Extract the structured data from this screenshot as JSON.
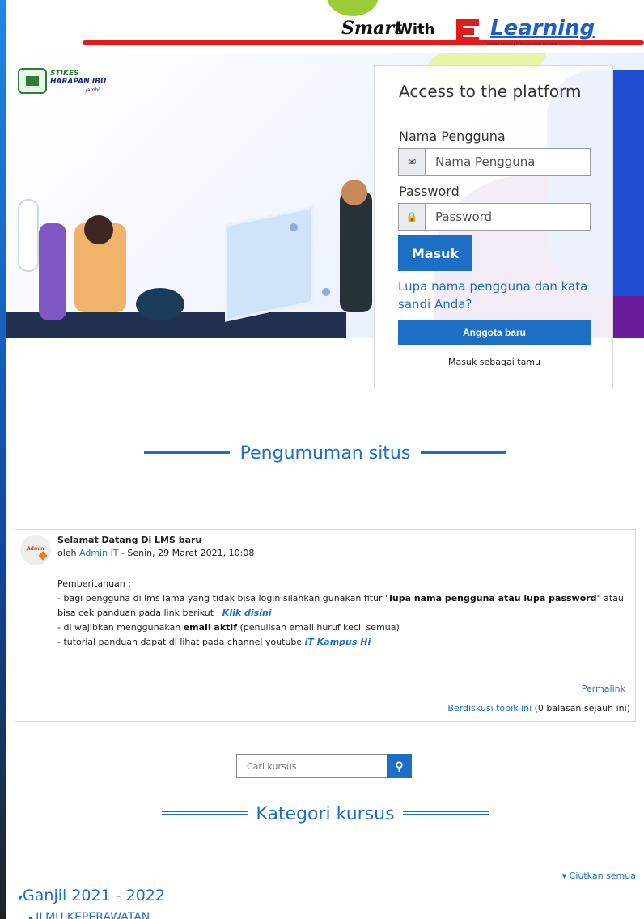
{
  "header": {
    "brand_smart": "Smart",
    "brand_with": "With",
    "brand_learning": "Learning",
    "brand_tagline": "Smart E-Learning STIKes Harapan Ibu Jambi"
  },
  "logo": {
    "line1": "STIKES",
    "line2": "HARAPAN IBU",
    "line3": "Jambi"
  },
  "login": {
    "title": "Access to the platform",
    "username_label": "Nama Pengguna",
    "username_placeholder": "Nama Pengguna",
    "password_label": "Password",
    "password_placeholder": "Password",
    "submit_label": "Masuk",
    "forgot_link": "Lupa nama pengguna dan kata sandi Anda?",
    "signup_label": "Anggota baru",
    "guest_label": "Masuk sebagai tamu"
  },
  "announcements": {
    "heading": "Pengumuman situs",
    "post": {
      "title": "Selamat Datang Di LMS baru",
      "by_prefix": "oleh",
      "author": "Admin iT",
      "date": "- Senin, 29 Maret 2021, 10:08",
      "line_intro": "Pemberitahuan :",
      "line1_a": "- bagi pengguna di lms lama yang tidak bisa login silahkan gunakan fitur \"",
      "line1_bold": "lupa nama pengguna atau lupa password",
      "line1_b": "\" atau bisa cek panduan pada link berikut : ",
      "line1_link": "Klik disini",
      "line2_a": "- di wajibkan menggunakan ",
      "line2_bold": "email aktif",
      "line2_b": " (penulisan email huruf kecil semua)",
      "line3_a": "- tutorial panduan dapat di lihat pada channel youtube ",
      "line3_link": "iT Kampus Hi",
      "permalink": "Permalink",
      "discuss_link": "Berdiskusi topik ini",
      "discuss_count": "(0 balasan sejauh ini)"
    }
  },
  "search": {
    "placeholder": "Cari kursus",
    "button_icon": "search-icon"
  },
  "categories": {
    "heading": "Kategori kursus",
    "collapse_label": "Ciutkan semua",
    "items": [
      {
        "label": "Ganjil 2021 - 2022"
      },
      {
        "label": "ILMU KEPERAWATAN"
      }
    ]
  },
  "colors": {
    "accent": "#1d6fc5",
    "brand_red": "#e21b1b"
  }
}
